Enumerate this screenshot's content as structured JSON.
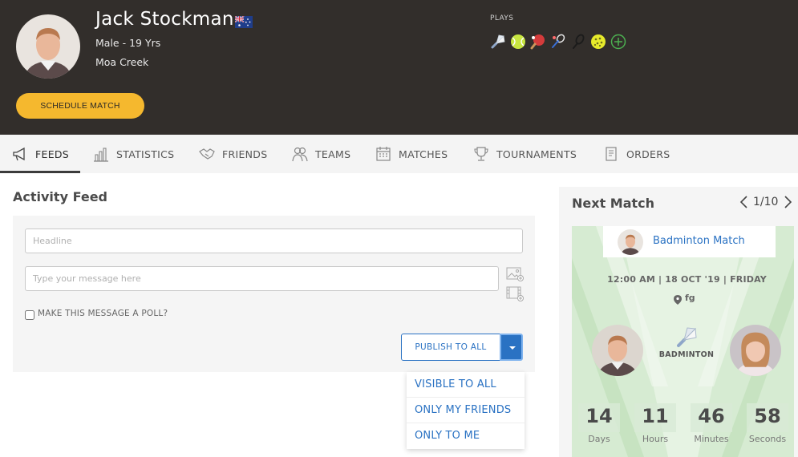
{
  "profile": {
    "name": "Jack Stockman",
    "gender_age": "Male - 19 Yrs",
    "location": "Moa Creek",
    "schedule_label": "SCHEDULE MATCH",
    "plays_label": "PLAYS",
    "sports_icons": [
      "badminton-icon",
      "tennis-ball-icon",
      "table-tennis-icon",
      "badminton-racket-icon",
      "squash-racket-icon",
      "pickleball-icon",
      "add-sport-icon"
    ]
  },
  "tabs": [
    {
      "label": "FEEDS",
      "icon": "megaphone-icon"
    },
    {
      "label": "STATISTICS",
      "icon": "bar-chart-icon"
    },
    {
      "label": "FRIENDS",
      "icon": "handshake-icon"
    },
    {
      "label": "TEAMS",
      "icon": "team-icon"
    },
    {
      "label": "MATCHES",
      "icon": "calendar-icon"
    },
    {
      "label": "TOURNAMENTS",
      "icon": "trophy-icon"
    },
    {
      "label": "ORDERS",
      "icon": "receipt-icon"
    }
  ],
  "feed": {
    "title": "Activity Feed",
    "headline_placeholder": "Headline",
    "message_placeholder": "Type your message here",
    "poll_label": "MAKE THIS MESSAGE A POLL?",
    "publish_label": "PUBLISH TO ALL",
    "visibility_options": [
      "VISIBLE TO ALL",
      "ONLY MY FRIENDS",
      "ONLY TO ME"
    ]
  },
  "next_match": {
    "title": "Next Match",
    "pager": "1/10",
    "match_name": "Badminton Match",
    "datetime": "12:00 AM | 18 OCT '19 | FRIDAY",
    "location": "fg",
    "sport": "BADMINTON",
    "countdown": [
      {
        "value": "14",
        "unit": "Days"
      },
      {
        "value": "11",
        "unit": "Hours"
      },
      {
        "value": "46",
        "unit": "Minutes"
      },
      {
        "value": "58",
        "unit": "Seconds"
      }
    ]
  },
  "colors": {
    "header_bg": "#322e2b",
    "accent_yellow": "#f5b82e",
    "link_blue": "#2a72c3"
  }
}
